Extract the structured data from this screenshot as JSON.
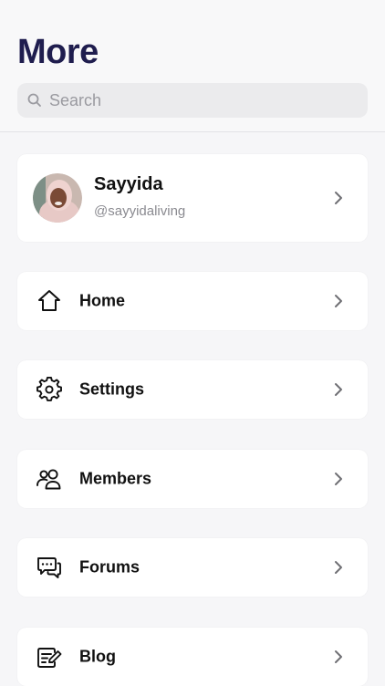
{
  "header": {
    "title": "More",
    "search_placeholder": "Search"
  },
  "profile": {
    "name": "Sayyida",
    "handle": "@sayyidaliving"
  },
  "menu": {
    "items": [
      {
        "label": "Home",
        "icon": "home-icon"
      },
      {
        "label": "Settings",
        "icon": "gear-icon"
      },
      {
        "label": "Members",
        "icon": "members-icon"
      },
      {
        "label": "Forums",
        "icon": "forums-icon"
      },
      {
        "label": "Blog",
        "icon": "blog-icon"
      }
    ]
  },
  "colors": {
    "title": "#1f1d4e",
    "background": "#f6f6f8",
    "card": "#ffffff",
    "muted": "#8a8a90"
  }
}
